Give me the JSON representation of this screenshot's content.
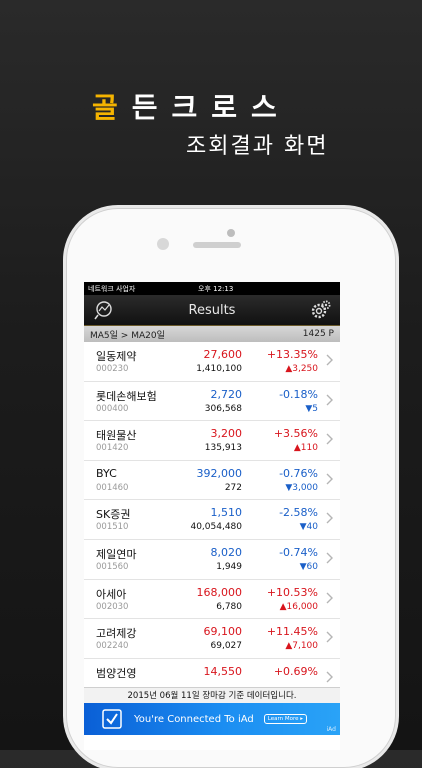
{
  "promo": {
    "title_accent": "골",
    "title_rest": "든크로스",
    "subtitle": "조회결과 화면"
  },
  "status_bar": {
    "carrier": "네트워크 사업자",
    "time": "오후 12:13"
  },
  "nav": {
    "title": "Results"
  },
  "section": {
    "label": "MA5일 > MA20일",
    "count": "1425 P"
  },
  "rows": [
    {
      "name": "일동제약",
      "code": "000230",
      "price": "27,600",
      "volume": "1,410,100",
      "pct": "+13.35%",
      "change": "▲3,250",
      "dir": "up"
    },
    {
      "name": "롯데손해보험",
      "code": "000400",
      "price": "2,720",
      "volume": "306,568",
      "pct": "-0.18%",
      "change": "▼5",
      "dir": "down"
    },
    {
      "name": "태원물산",
      "code": "001420",
      "price": "3,200",
      "volume": "135,913",
      "pct": "+3.56%",
      "change": "▲110",
      "dir": "up"
    },
    {
      "name": "BYC",
      "code": "001460",
      "price": "392,000",
      "volume": "272",
      "pct": "-0.76%",
      "change": "▼3,000",
      "dir": "down"
    },
    {
      "name": "SK증권",
      "code": "001510",
      "price": "1,510",
      "volume": "40,054,480",
      "pct": "-2.58%",
      "change": "▼40",
      "dir": "down"
    },
    {
      "name": "제일연마",
      "code": "001560",
      "price": "8,020",
      "volume": "1,949",
      "pct": "-0.74%",
      "change": "▼60",
      "dir": "down"
    },
    {
      "name": "아세아",
      "code": "002030",
      "price": "168,000",
      "volume": "6,780",
      "pct": "+10.53%",
      "change": "▲16,000",
      "dir": "up"
    },
    {
      "name": "고려제강",
      "code": "002240",
      "price": "69,100",
      "volume": "69,027",
      "pct": "+11.45%",
      "change": "▲7,100",
      "dir": "up"
    },
    {
      "name": "범양건영",
      "code": "",
      "price": "14,550",
      "volume": "",
      "pct": "+0.69%",
      "change": "",
      "dir": "up"
    }
  ],
  "footer": {
    "note": "2015년 06월 11일 장마감 기준 데이터입니다."
  },
  "ad": {
    "text": "You're Connected To iAd",
    "learn_more": "Learn More ▸",
    "logo": "iAd"
  },
  "colors": {
    "up": "#d8151d",
    "down": "#1a5fc8",
    "accent_gold": "#f5b400"
  }
}
